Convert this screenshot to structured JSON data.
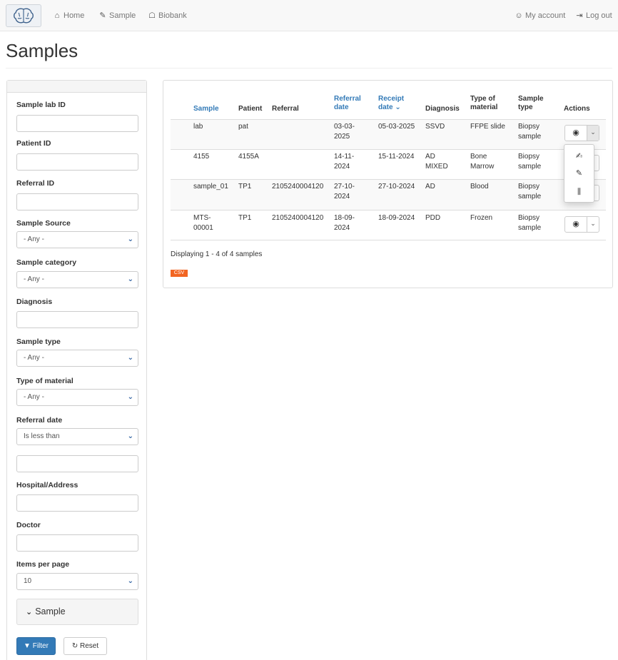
{
  "nav": {
    "home": "Home",
    "sample": "Sample",
    "biobank": "Biobank",
    "account": "My account",
    "logout": "Log out"
  },
  "page_title": "Samples",
  "filters": {
    "sample_lab_id": {
      "label": "Sample lab ID",
      "value": ""
    },
    "patient_id": {
      "label": "Patient ID",
      "value": ""
    },
    "referral_id": {
      "label": "Referral ID",
      "value": ""
    },
    "sample_source": {
      "label": "Sample Source",
      "value": "- Any -"
    },
    "sample_category": {
      "label": "Sample category",
      "value": "- Any -"
    },
    "diagnosis": {
      "label": "Diagnosis",
      "value": ""
    },
    "sample_type": {
      "label": "Sample type",
      "value": "- Any -"
    },
    "type_of_material": {
      "label": "Type of material",
      "value": "- Any -"
    },
    "referral_date": {
      "label": "Referral date",
      "operator": "Is less than",
      "value": ""
    },
    "hospital": {
      "label": "Hospital/Address",
      "value": ""
    },
    "doctor": {
      "label": "Doctor",
      "value": ""
    },
    "items_per_page": {
      "label": "Items per page",
      "value": "10"
    },
    "collapse_label": "Sample",
    "filter_button": "Filter",
    "reset_button": "Reset"
  },
  "table": {
    "headers": {
      "sample": "Sample",
      "patient": "Patient",
      "referral": "Referral",
      "referral_date_1": "Referral",
      "referral_date_2": "date",
      "receipt_date_1": "Receipt",
      "receipt_date_2": "date",
      "diagnosis": "Diagnosis",
      "material_1": "Type of",
      "material_2": "material",
      "sample_type_1": "Sample",
      "sample_type_2": "type",
      "actions": "Actions"
    },
    "rows": [
      {
        "sample": "lab",
        "sample_2": "",
        "patient": "pat",
        "referral": "",
        "referral_date": "03-03-",
        "referral_date_2": "2025",
        "receipt_date": "05-03-2025",
        "diagnosis": "SSVD",
        "diagnosis_2": "",
        "material": "FFPE slide",
        "material_2": "",
        "sample_type": "Biopsy",
        "sample_type_2": "sample"
      },
      {
        "sample": "4155",
        "sample_2": "",
        "patient": "4155A",
        "referral": "",
        "referral_date": "14-11-",
        "referral_date_2": "2024",
        "receipt_date": "15-11-2024",
        "diagnosis": "AD",
        "diagnosis_2": "MIXED",
        "material": "Bone",
        "material_2": "Marrow",
        "sample_type": "Biopsy",
        "sample_type_2": "sample"
      },
      {
        "sample": "sample_01",
        "sample_2": "",
        "patient": "TP1",
        "referral": "2105240004120",
        "referral_date": "27-10-",
        "referral_date_2": "2024",
        "receipt_date": "27-10-2024",
        "diagnosis": "AD",
        "diagnosis_2": "",
        "material": "Blood",
        "material_2": "",
        "sample_type": "Biopsy",
        "sample_type_2": "sample"
      },
      {
        "sample": "MTS-",
        "sample_2": "00001",
        "patient": "TP1",
        "referral": "2105240004120",
        "referral_date": "18-09-",
        "referral_date_2": "2024",
        "receipt_date": "18-09-2024",
        "diagnosis": "PDD",
        "diagnosis_2": "",
        "material": "Frozen",
        "material_2": "",
        "sample_type": "Biopsy",
        "sample_type_2": "sample"
      }
    ],
    "summary": "Displaying 1 - 4 of 4 samples",
    "csv_label": "CSV"
  },
  "colors": {
    "primary": "#337ab7",
    "csv": "#f26522"
  },
  "icons": [
    "brain-logo-icon",
    "home-icon",
    "pencil-icon",
    "bank-icon",
    "user-icon",
    "logout-icon",
    "chevron-down-icon",
    "filter-icon",
    "refresh-icon",
    "eye-icon",
    "caret-down-icon",
    "edit-icon",
    "tubes-icon"
  ]
}
